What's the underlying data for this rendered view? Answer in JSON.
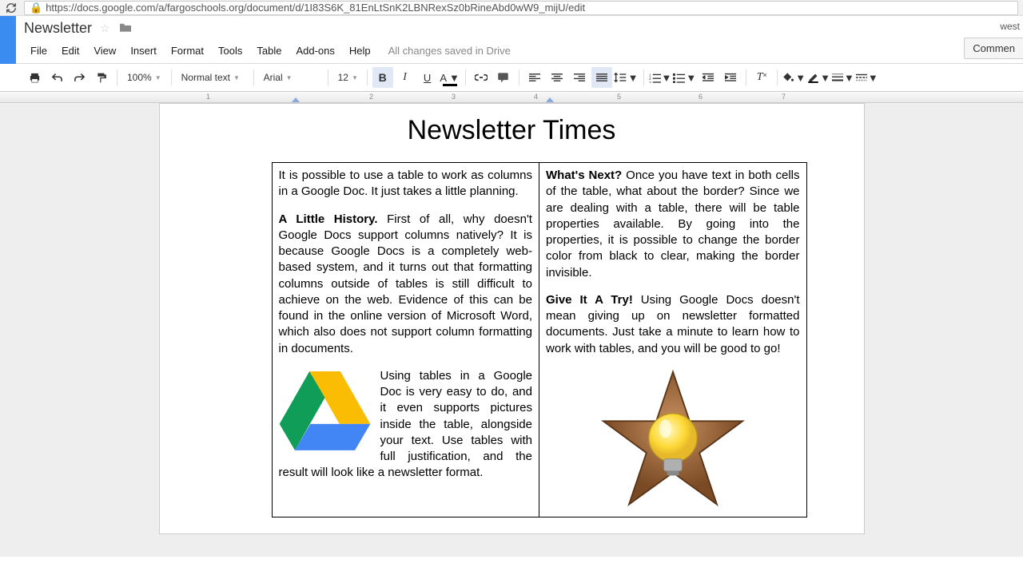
{
  "browser": {
    "url": "https://docs.google.com/a/fargoschools.org/document/d/1I83S6K_81EnLtSnK2LBNRexSz0bRineAbd0wW9_mijU/edit"
  },
  "doc": {
    "title": "Newsletter",
    "save_status": "All changes saved in Drive",
    "user_label": "west",
    "comments_label": "Commen"
  },
  "menus": [
    "File",
    "Edit",
    "View",
    "Insert",
    "Format",
    "Tools",
    "Table",
    "Add-ons",
    "Help"
  ],
  "toolbar": {
    "zoom": "100%",
    "style": "Normal text",
    "font": "Arial",
    "size": "12"
  },
  "ruler": {
    "nums": [
      "1",
      "2",
      "3",
      "4",
      "5",
      "6",
      "7"
    ]
  },
  "content": {
    "heading": "Newsletter Times",
    "col1": {
      "p1": "It is possible to use a table to work as columns in a Google Doc. It just takes a little planning.",
      "p2_lead": "A Little History.",
      "p2_body": " First of all, why doesn't Google Docs support columns natively? It is because Google Docs is a completely web-based system, and it turns out that formatting columns outside of tables is still difficult to achieve on the web. Evidence of this can be found in the online version of Microsoft Word, which also does not support column formatting in documents.",
      "p3": "Using tables in a Google Doc is very easy to do, and it even supports pictures inside the table, alongside your text. Use tables with full justification, and the result will look like a newsletter format."
    },
    "col2": {
      "p1_lead": "What's Next?",
      "p1_body": " Once you have text in both cells of the table, what about the border? Since we are dealing with a table, there will be table properties available. By going into the properties, it is possible to change the border color from black to clear, making the border invisible.",
      "p2_lead": "Give It A Try!",
      "p2_body": " Using Google Docs doesn't mean giving up on newsletter formatted documents. Just take a minute to learn how to work with tables, and you will be good to go!"
    }
  }
}
